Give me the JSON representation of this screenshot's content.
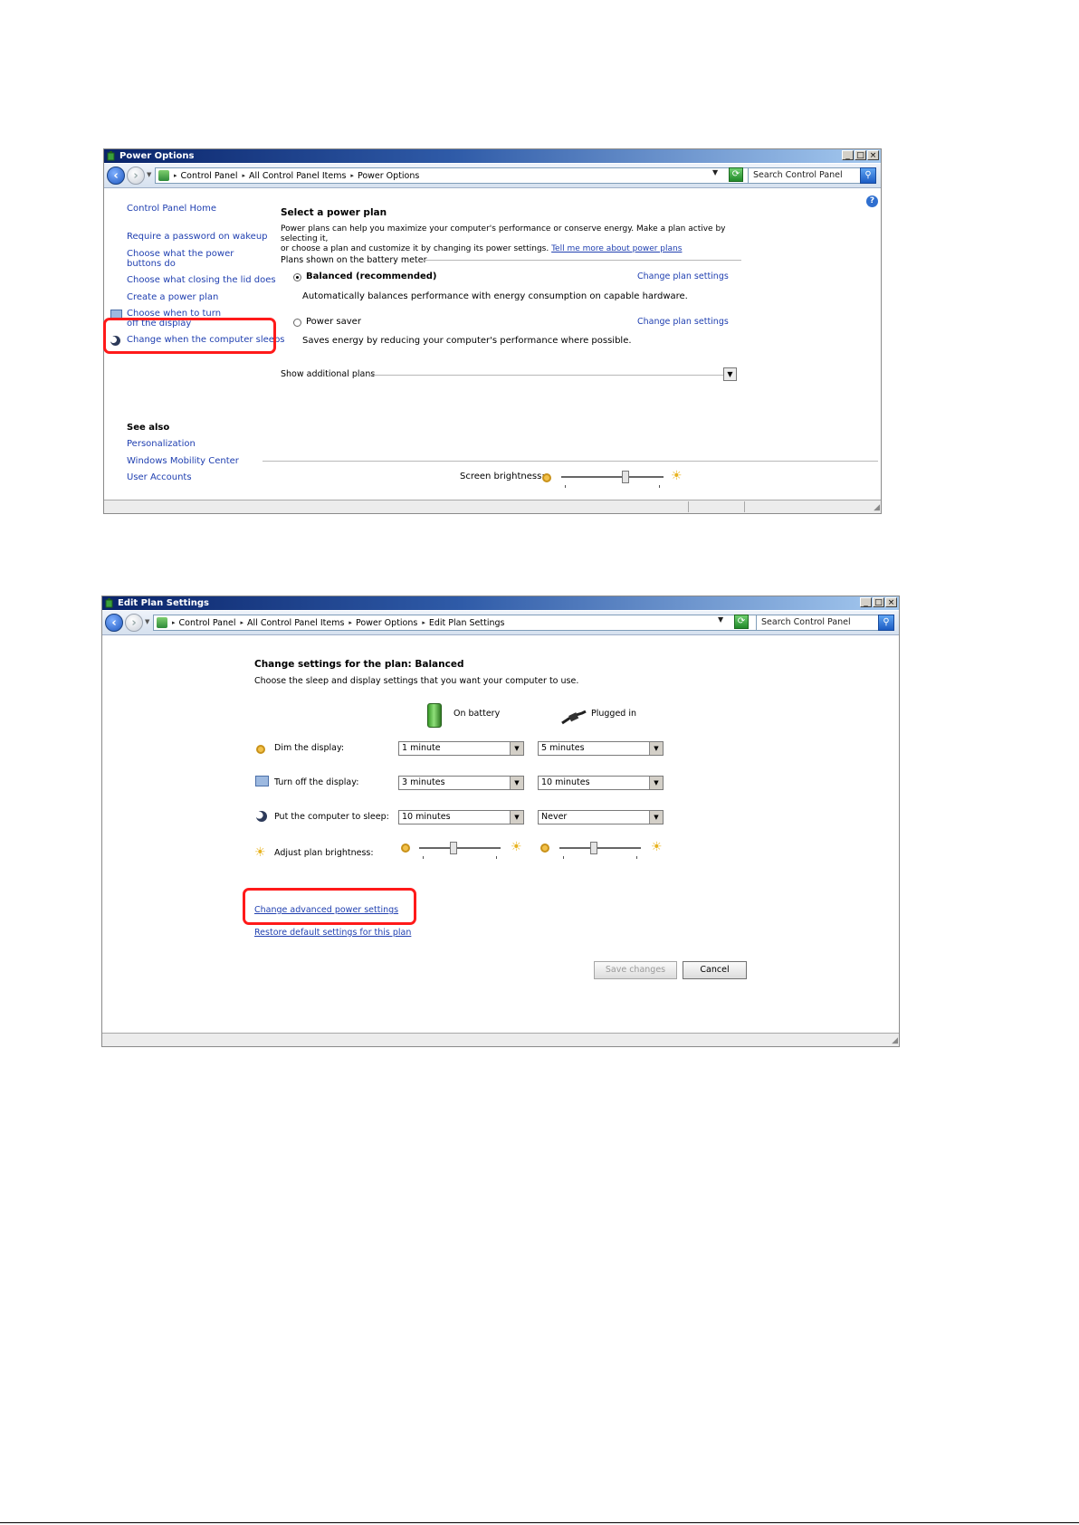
{
  "window1": {
    "title": "Power Options",
    "controls": {
      "minimize": "_",
      "maximize": "□",
      "close": "×"
    },
    "breadcrumbs": [
      "Control Panel",
      "All Control Panel Items",
      "Power Options"
    ],
    "search_placeholder": "Search Control Panel",
    "help_icon": "?",
    "sidebar": {
      "home": "Control Panel Home",
      "tasks": [
        "Require a password on wakeup",
        "Choose what the power buttons do",
        "Choose what closing the lid does",
        "Create a power plan",
        "Choose when to turn off the display",
        "Change when the computer sleeps"
      ],
      "see_also_heading": "See also",
      "see_also": [
        "Personalization",
        "Windows Mobility Center",
        "User Accounts"
      ]
    },
    "main": {
      "heading": "Select a power plan",
      "intro_line1": "Power plans can help you maximize your computer's performance or conserve energy. Make a plan active by selecting it,",
      "intro_line2": "or choose a plan and customize it by changing its power settings.",
      "intro_link": "Tell me more about power plans",
      "group_label": "Plans shown on the battery meter",
      "plans": [
        {
          "name": "Balanced (recommended)",
          "selected": true,
          "description": "Automatically balances performance with energy consumption on capable hardware.",
          "settings_link": "Change plan settings"
        },
        {
          "name": "Power saver",
          "selected": false,
          "description": "Saves energy by reducing your computer's performance where possible.",
          "settings_link": "Change plan settings"
        }
      ],
      "show_additional": "Show additional plans",
      "brightness_label": "Screen brightness:",
      "brightness_level": 0.64
    }
  },
  "window2": {
    "title": "Edit Plan Settings",
    "controls": {
      "minimize": "_",
      "maximize": "□",
      "close": "×"
    },
    "breadcrumbs": [
      "Control Panel",
      "All Control Panel Items",
      "Power Options",
      "Edit Plan Settings"
    ],
    "search_placeholder": "Search Control Panel",
    "heading": "Change settings for the plan: Balanced",
    "subheading": "Choose the sleep and display settings that you want your computer to use.",
    "columns": {
      "battery": "On battery",
      "plugged": "Plugged in"
    },
    "rows": [
      {
        "label": "Dim the display:",
        "battery": "1 minute",
        "plugged": "5 minutes"
      },
      {
        "label": "Turn off the display:",
        "battery": "3 minutes",
        "plugged": "10 minutes"
      },
      {
        "label": "Put the computer to sleep:",
        "battery": "10 minutes",
        "plugged": "Never"
      }
    ],
    "brightness_label": "Adjust plan brightness:",
    "brightness": {
      "battery": 0.42,
      "plugged": 0.42
    },
    "advanced_link": "Change advanced power settings",
    "restore_link": "Restore default settings for this plan",
    "save_label": "Save changes",
    "cancel_label": "Cancel"
  },
  "highlight_color": "#ff1a1a"
}
